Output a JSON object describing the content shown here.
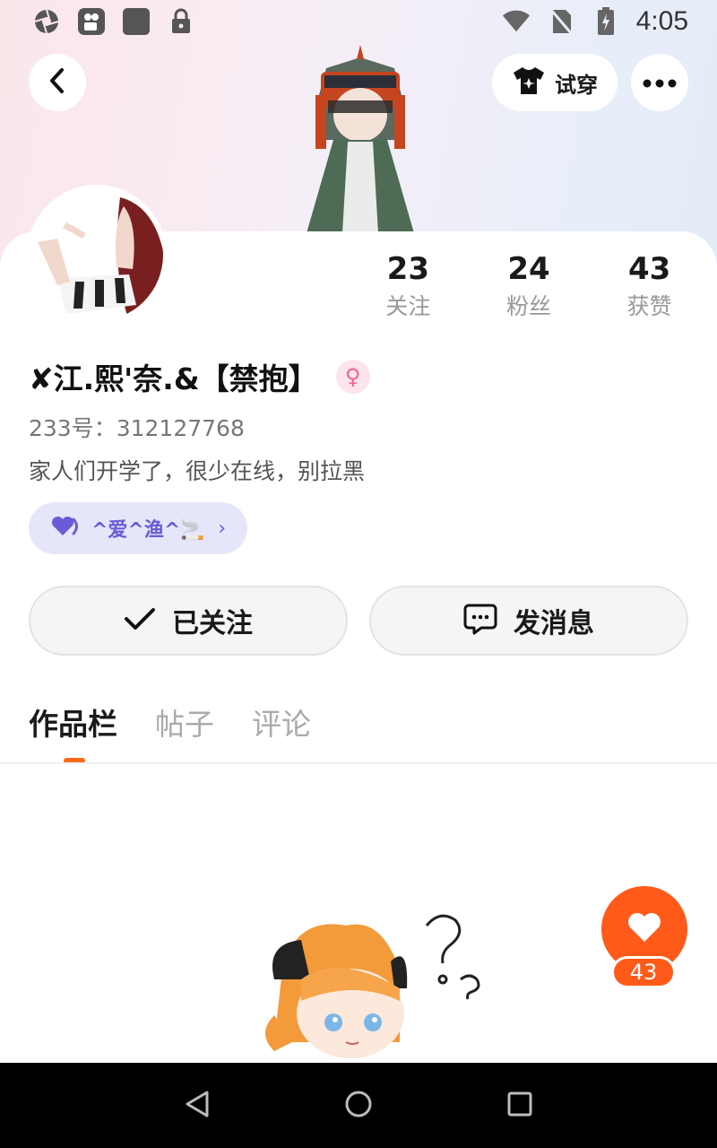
{
  "status_bar": {
    "time": "4:05"
  },
  "top_bar": {
    "try_on_label": "试穿"
  },
  "profile": {
    "stats": [
      {
        "value": "23",
        "label": "关注"
      },
      {
        "value": "24",
        "label": "粉丝"
      },
      {
        "value": "43",
        "label": "获赞"
      }
    ],
    "username": "✘江.熙'奈.&【禁抱】",
    "gender_symbol": "♀",
    "user_id": "233号：312127768",
    "bio": "家人们开学了，很少在线，别拉黑",
    "tag": {
      "text": "^爱^渔^🚬",
      "chevron": "›"
    }
  },
  "actions": {
    "follow_label": "已关注",
    "message_label": "发消息"
  },
  "tabs": [
    {
      "label": "作品栏",
      "active": true
    },
    {
      "label": "帖子",
      "active": false
    },
    {
      "label": "评论",
      "active": false
    }
  ],
  "like_fab": {
    "count": "43"
  },
  "colors": {
    "accent": "#ff5a1a",
    "tag_bg": "#e6e6fb",
    "tag_text": "#6b5bd6"
  }
}
